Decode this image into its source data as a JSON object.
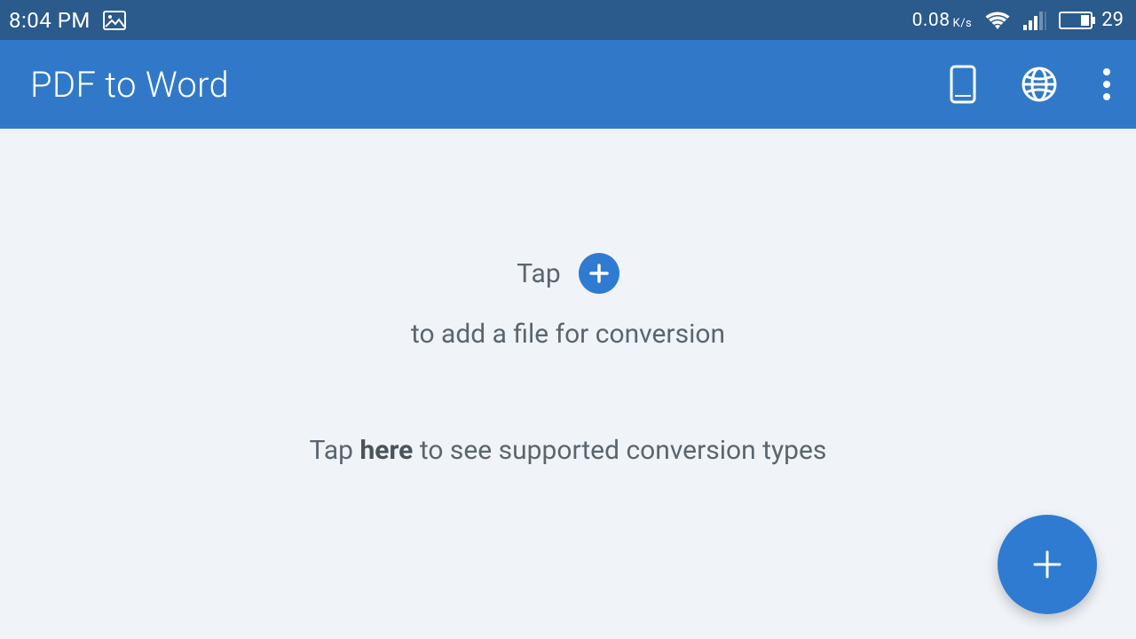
{
  "status": {
    "time": "8:04 PM",
    "data_rate": "0.08",
    "data_unit": "K/s",
    "battery_text": "29"
  },
  "appbar": {
    "title": "PDF to Word"
  },
  "empty": {
    "tap_label": "Tap",
    "add_file_label": "to add a file for conversion",
    "supported_prefix": "Tap ",
    "supported_here": "here",
    "supported_suffix": " to see supported conversion types"
  }
}
